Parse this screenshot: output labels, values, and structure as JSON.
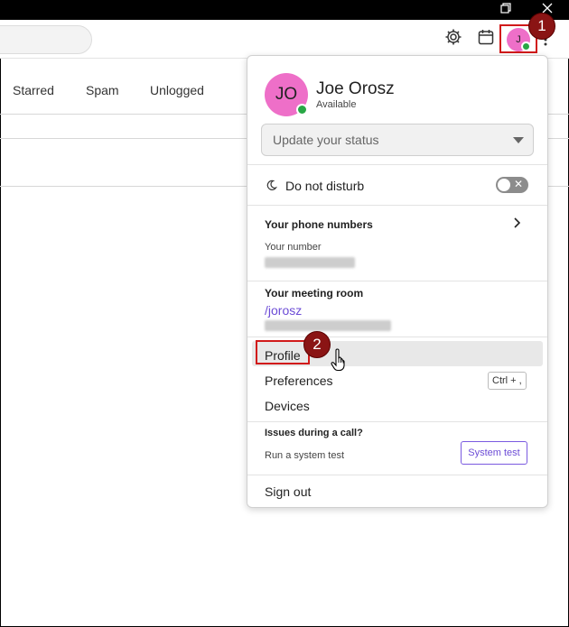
{
  "window": {
    "restore_icon": "restore-icon",
    "close_icon": "close-icon"
  },
  "toolbar": {
    "avatar_initial": "J",
    "icons": [
      "gear-icon",
      "calendar-icon",
      "more-vert-icon"
    ]
  },
  "tabs": [
    {
      "label": "Starred"
    },
    {
      "label": "Spam"
    },
    {
      "label": "Unlogged"
    }
  ],
  "callouts": [
    "1",
    "2"
  ],
  "menu": {
    "avatar_initials": "JO",
    "name": "Joe Orosz",
    "availability": "Available",
    "status_placeholder": "Update your status",
    "dnd_label": "Do not disturb",
    "phone_header": "Your phone numbers",
    "your_number_label": "Your number",
    "meeting_header": "Your meeting room",
    "meeting_link": "/jorosz",
    "profile": "Profile",
    "preferences": "Preferences",
    "preferences_shortcut": "Ctrl + ,",
    "devices": "Devices",
    "issues_header": "Issues during a call?",
    "system_test_label": "Run a system test",
    "system_test_button": "System test",
    "sign_out": "Sign out"
  },
  "colors": {
    "avatar": "#ee6fc8",
    "online": "#28a745",
    "accent": "#6c4cd6",
    "callout": "#8a1414"
  }
}
